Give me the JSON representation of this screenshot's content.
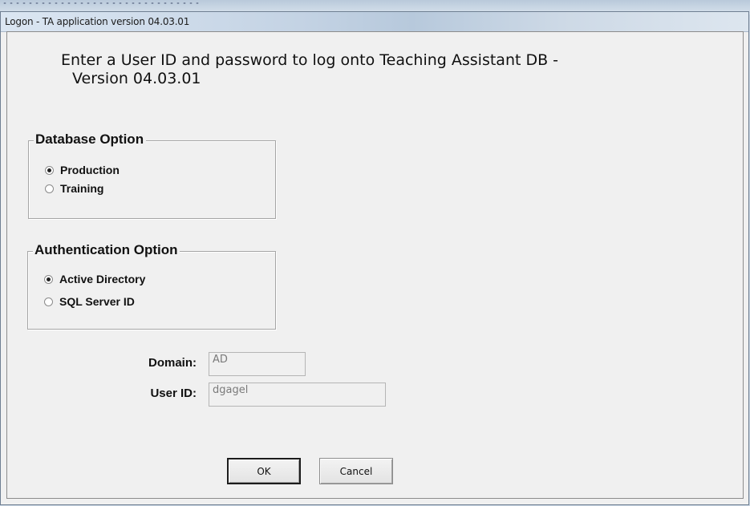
{
  "window": {
    "title": "Logon - TA application version 04.03.01"
  },
  "heading": {
    "line1": "Enter a User ID and password to log onto Teaching Assistant DB -",
    "line2": "Version 04.03.01"
  },
  "database_option": {
    "title": "Database Option",
    "options": [
      {
        "label": "Production",
        "selected": true
      },
      {
        "label": "Training",
        "selected": false
      }
    ]
  },
  "authentication_option": {
    "title": "Authentication Option",
    "options": [
      {
        "label": "Active Directory",
        "selected": true
      },
      {
        "label": "SQL Server ID",
        "selected": false
      }
    ]
  },
  "fields": {
    "domain_label": "Domain:",
    "domain_value": "AD",
    "userid_label": "User ID:",
    "userid_value": "dgagel"
  },
  "buttons": {
    "ok": "OK",
    "cancel": "Cancel"
  }
}
